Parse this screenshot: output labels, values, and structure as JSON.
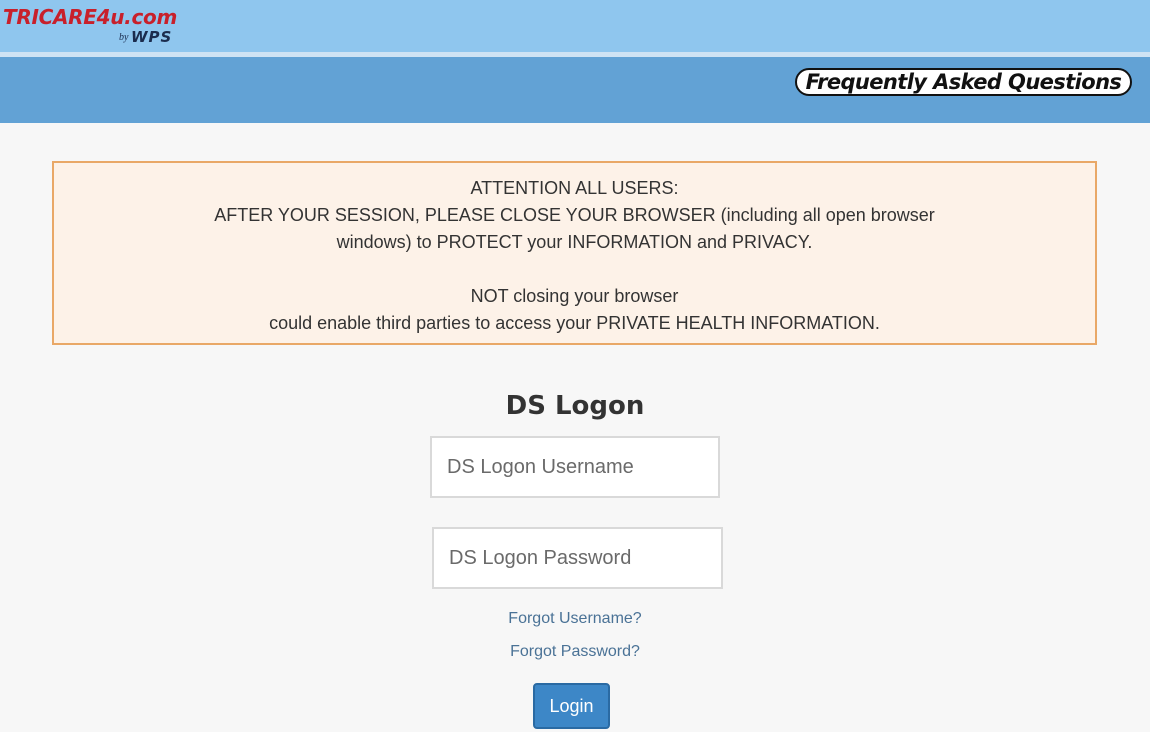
{
  "header": {
    "logo_main": "TRICARE4u.com",
    "logo_by": "by",
    "logo_wps": "WPS"
  },
  "nav": {
    "faq_label": "Frequently Asked Questions"
  },
  "notice": {
    "line1": "ATTENTION ALL USERS:",
    "line2": "AFTER YOUR SESSION, PLEASE CLOSE YOUR BROWSER (including all open browser",
    "line3": "windows) to PROTECT your INFORMATION and PRIVACY.",
    "line4": "NOT closing your browser",
    "line5": "could enable third parties to access your PRIVATE HEALTH INFORMATION."
  },
  "login": {
    "title": "DS Logon",
    "username_placeholder": "DS Logon Username",
    "password_placeholder": "DS Logon Password",
    "forgot_username": "Forgot Username?",
    "forgot_password": "Forgot Password?",
    "button_label": "Login"
  },
  "colors": {
    "top_bar": "#8fc6ee",
    "nav_bar": "#62a2d5",
    "notice_bg": "#fdf2e8",
    "notice_border": "#e9a867",
    "logo_red": "#c8202b",
    "logo_navy": "#1b2c4e",
    "button": "#3d87c7",
    "link": "#4a7296"
  }
}
